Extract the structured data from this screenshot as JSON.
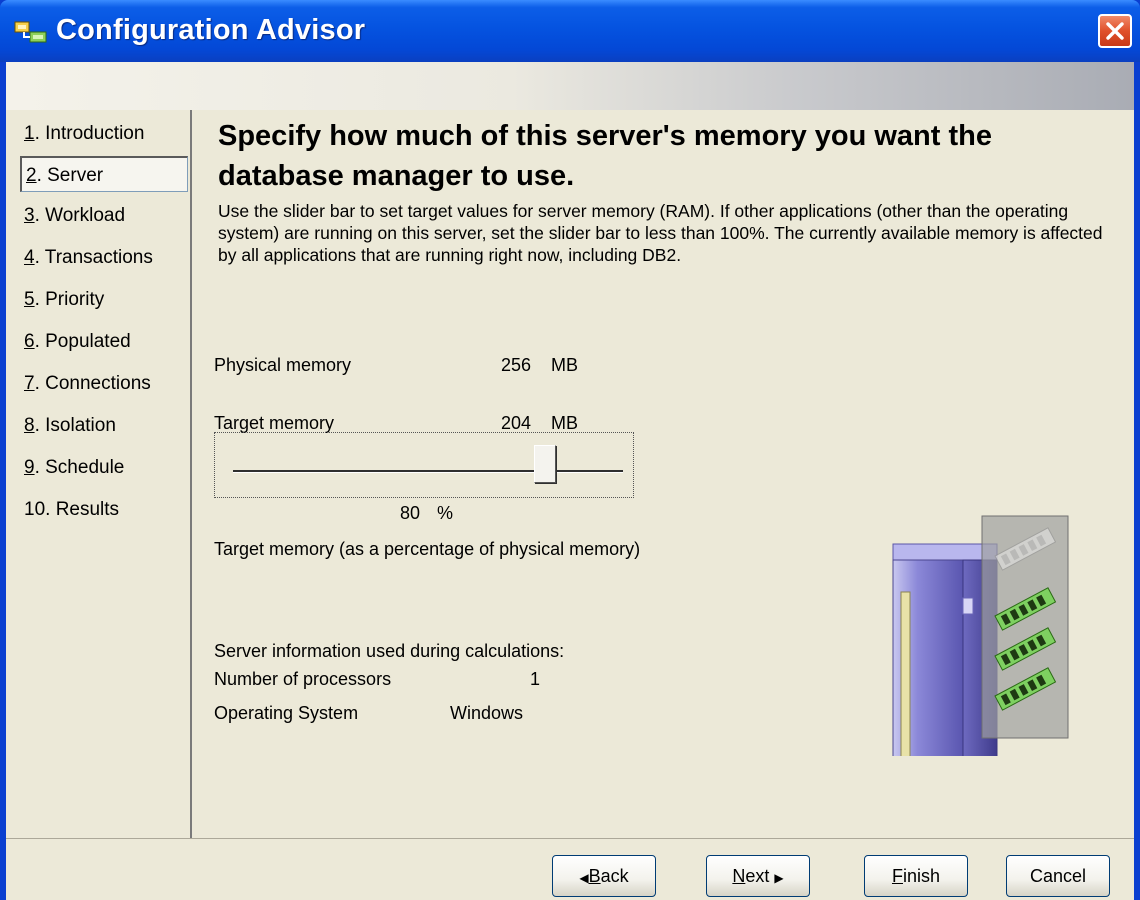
{
  "window": {
    "title": "Configuration Advisor"
  },
  "sidebar": {
    "items": [
      {
        "num": "1",
        "label": ". Introduction"
      },
      {
        "num": "2",
        "label": ". Server"
      },
      {
        "num": "3",
        "label": ". Workload"
      },
      {
        "num": "4",
        "label": ". Transactions"
      },
      {
        "num": "5",
        "label": ". Priority"
      },
      {
        "num": "6",
        "label": ". Populated"
      },
      {
        "num": "7",
        "label": ". Connections"
      },
      {
        "num": "8",
        "label": ". Isolation"
      },
      {
        "num": "9",
        "label": ". Schedule"
      },
      {
        "num": "",
        "label": "10. Results"
      }
    ],
    "selected_index": 1
  },
  "main": {
    "heading": "Specify how much of this server's memory you want the database manager to use.",
    "description": "Use the slider bar to set target values for server memory (RAM). If other applications (other than the operating system) are running on this server, set the slider bar to less than 100%. The currently available memory is affected by all applications that are running right now, including DB2.",
    "physical_memory": {
      "label": "Physical memory",
      "value": "256",
      "unit": "MB"
    },
    "target_memory": {
      "label": "Target memory",
      "value": "204",
      "unit": "MB"
    },
    "slider": {
      "value_percent": 80,
      "value_text": "80",
      "unit": "%"
    },
    "slider_caption": "Target memory (as a percentage of physical memory)",
    "server_info": {
      "heading": "Server information used during calculations:",
      "processors_label": "Number of processors",
      "processors_value": "1",
      "os_label": "Operating System",
      "os_value": "Windows"
    }
  },
  "footer": {
    "back": {
      "mnemonic": "B",
      "rest": "ack"
    },
    "next": {
      "mnemonic": "N",
      "rest": "ext"
    },
    "finish": {
      "mnemonic": "F",
      "rest": "inish"
    },
    "cancel": {
      "label": "Cancel"
    }
  },
  "colors": {
    "title_bar": "#0553e0",
    "dialog_bg": "#ece9d8",
    "close_button": "#e0502a"
  }
}
